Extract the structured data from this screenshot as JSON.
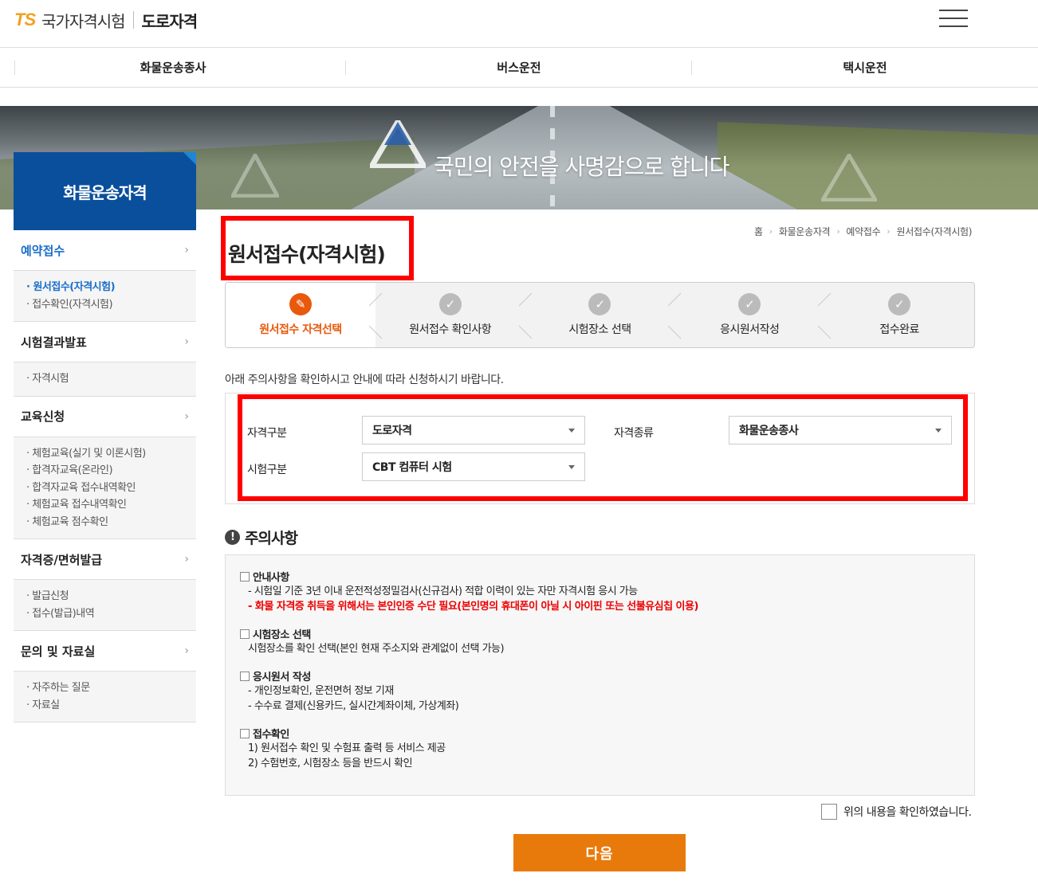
{
  "header": {
    "logo_ts": "TS",
    "logo_org": "국가자격시험",
    "logo_sub": "도로자격"
  },
  "gnb": [
    "화물운송종사",
    "버스운전",
    "택시운전"
  ],
  "banner": {
    "slogan": "국민의 안전을 사명감으로 합니다"
  },
  "sidebar": {
    "title": "화물운송자격",
    "sections": [
      {
        "label": "예약접수",
        "items": [
          "원서접수(자격시험)",
          "접수확인(자격시험)"
        ]
      },
      {
        "label": "시험결과발표",
        "items": [
          "자격시험"
        ]
      },
      {
        "label": "교육신청",
        "items": [
          "체험교육(실기 및 이론시험)",
          "합격자교육(온라인)",
          "합격자교육 접수내역확인",
          "체험교육 접수내역확인",
          "체험교육 점수확인"
        ]
      },
      {
        "label": "자격증/면허발급",
        "items": [
          "발급신청",
          "접수(발급)내역"
        ]
      },
      {
        "label": "문의 및 자료실",
        "items": [
          "자주하는 질문",
          "자료실"
        ]
      }
    ]
  },
  "breadcrumb": [
    "홈",
    "화물운송자격",
    "예약접수",
    "원서접수(자격시험)"
  ],
  "page_title": "원서접수(자격시험)",
  "steps": [
    "원서접수 자격선택",
    "원서접수 확인사항",
    "시험장소 선택",
    "응시원서작성",
    "접수완료"
  ],
  "notice": "아래 주의사항을 확인하시고 안내에 따라 신청하시기 바랍니다.",
  "form": {
    "qual_type_label": "자격구분",
    "qual_type_value": "도로자격",
    "qual_kind_label": "자격종류",
    "qual_kind_value": "화물운송종사",
    "exam_type_label": "시험구분",
    "exam_type_value": "CBT 컴퓨터 시험"
  },
  "caution": {
    "title": "주의사항",
    "groups": [
      {
        "head": "안내사항",
        "lines": [
          "- 시험일 기준 3년 이내 운전적성정밀검사(신규검사) 적합 이력이 있는 자만 자격시험 응시 가능",
          "- 화물 자격증 취득을 위해서는 본인인증 수단 필요(본인명의 휴대폰이 아닐 시 아이핀 또는 선불유심칩 이용)"
        ]
      },
      {
        "head": "시험장소 선택",
        "lines": [
          "시험장소를 확인 선택(본인 현재 주소지와 관계없이 선택 가능)"
        ]
      },
      {
        "head": "응시원서 작성",
        "lines": [
          "- 개인정보확인, 운전면허 정보 기재",
          "- 수수료 결제(신용카드, 실시간계좌이체, 가상계좌)"
        ]
      },
      {
        "head": "접수확인",
        "lines": [
          "1) 원서접수 확인 및 수험표 출력 등 서비스 제공",
          "2) 수험번호, 시험장소 등을 반드시 확인"
        ]
      }
    ]
  },
  "agree_label": "위의 내용을 확인하였습니다.",
  "next_button": "다음",
  "colors": {
    "brand_blue": "#0a4f9c",
    "accent_orange": "#e87a0c",
    "active_step": "#e8590c",
    "highlight_red": "#ff0000"
  }
}
